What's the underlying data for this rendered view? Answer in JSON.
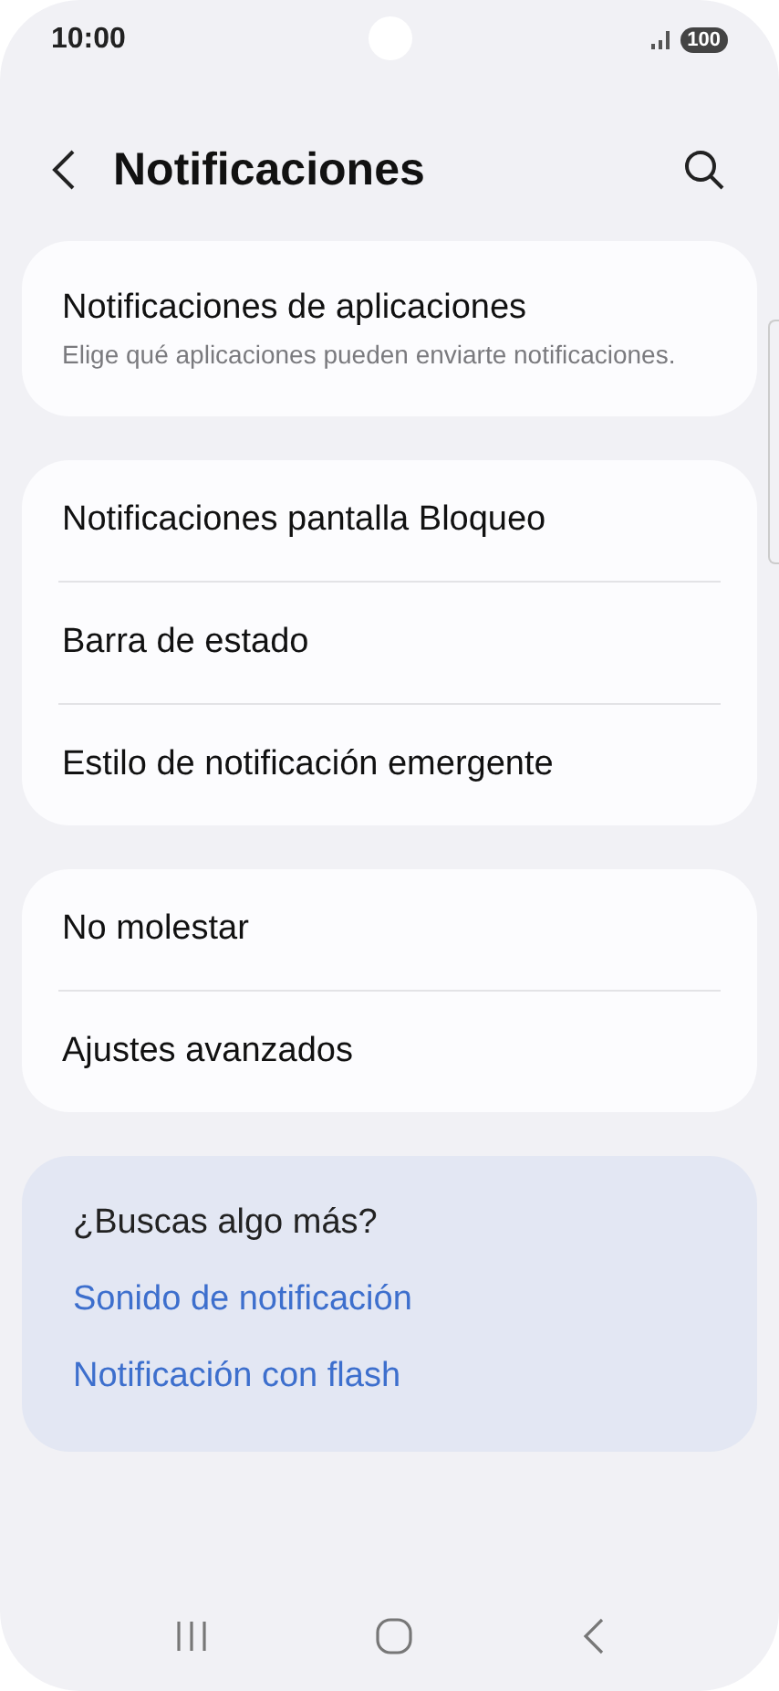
{
  "status_bar": {
    "time": "10:00",
    "battery": "100"
  },
  "header": {
    "title": "Notificaciones"
  },
  "groups": [
    {
      "items": [
        {
          "title": "Notificaciones de aplicaciones",
          "subtitle": "Elige qué aplicaciones pueden enviarte notificaciones."
        }
      ]
    },
    {
      "items": [
        {
          "title": "Notificaciones pantalla Bloqueo"
        },
        {
          "title": "Barra de estado"
        },
        {
          "title": "Estilo de notificación emergente"
        }
      ]
    },
    {
      "items": [
        {
          "title": "No molestar"
        },
        {
          "title": "Ajustes avanzados"
        }
      ]
    }
  ],
  "suggestions": {
    "title": "¿Buscas algo más?",
    "links": [
      "Sonido de notificación",
      "Notificación con flash"
    ]
  }
}
